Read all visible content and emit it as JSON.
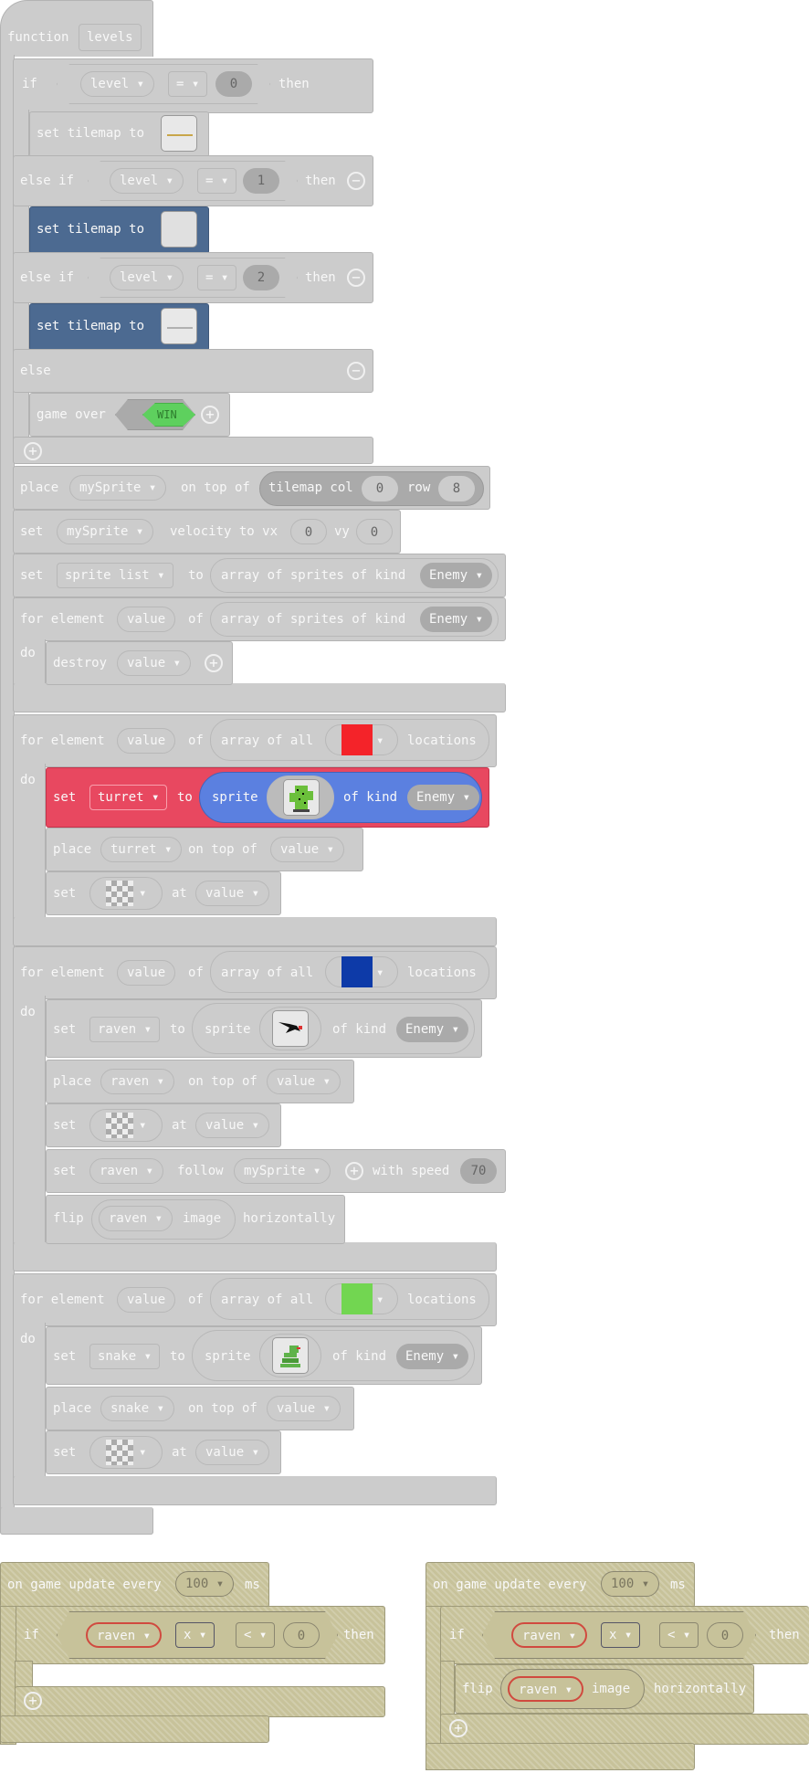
{
  "function_block": {
    "keyword": "function",
    "name": "levels"
  },
  "if_level0": {
    "if": "if",
    "var": "level",
    "op": "=",
    "value": "0",
    "then": "then"
  },
  "set_tilemap_1": {
    "label1": "set tilemap to"
  },
  "elseif_level1": {
    "elseif": "else if",
    "var": "level",
    "op": "=",
    "value": "1",
    "then": "then"
  },
  "set_tilemap_2": {
    "label1": "set tilemap to"
  },
  "elseif_level2": {
    "elseif": "else if",
    "var": "level",
    "op": "=",
    "value": "2",
    "then": "then"
  },
  "set_tilemap_3": {
    "label1": "set tilemap to"
  },
  "else_block": {
    "else": "else"
  },
  "game_over": {
    "label": "game over",
    "result": "WIN"
  },
  "place_mysprite": {
    "place": "place",
    "sprite": "mySprite",
    "on_top_of": "on top of",
    "tilemap_col": "tilemap col",
    "col": "0",
    "row_label": "row",
    "row": "8"
  },
  "set_velocity": {
    "set": "set",
    "sprite": "mySprite",
    "velocity": "velocity to vx",
    "vx": "0",
    "vy_label": "vy",
    "vy": "0"
  },
  "set_sprite_list": {
    "set": "set",
    "var": "sprite list",
    "to": "to",
    "array": "array of sprites of kind",
    "kind": "Enemy"
  },
  "for_destroy": {
    "for_element": "for element",
    "var": "value",
    "of": "of",
    "array": "array of sprites of kind",
    "kind": "Enemy",
    "do": "do",
    "destroy": "destroy",
    "destroy_var": "value"
  },
  "for_red": {
    "for_element": "for element",
    "var": "value",
    "of": "of",
    "array": "array of all",
    "locations": "locations",
    "do": "do",
    "color": "#f42329",
    "set": "set",
    "set_var": "turret",
    "to": "to",
    "sprite": "sprite",
    "of_kind": "of kind",
    "kind": "Enemy",
    "place": "place",
    "place_var": "turret",
    "on_top_of": "on top of",
    "target": "value",
    "set2": "set",
    "at": "at",
    "at_var": "value"
  },
  "for_blue": {
    "for_element": "for element",
    "var": "value",
    "of": "of",
    "array": "array of all",
    "locations": "locations",
    "do": "do",
    "color": "#0d3aa8",
    "set": "set",
    "set_var": "raven",
    "to": "to",
    "sprite": "sprite",
    "of_kind": "of kind",
    "kind": "Enemy",
    "place": "place",
    "place_var": "raven",
    "on_top_of": "on top of",
    "target": "value",
    "set2": "set",
    "at": "at",
    "at_var": "value",
    "follow_set": "set",
    "follow_var": "raven",
    "follow": "follow",
    "follow_target": "mySprite",
    "with_speed": "with speed",
    "speed": "70",
    "flip": "flip",
    "flip_var": "raven",
    "image": "image",
    "horizontally": "horizontally"
  },
  "for_green": {
    "for_element": "for element",
    "var": "value",
    "of": "of",
    "array": "array of all",
    "locations": "locations",
    "do": "do",
    "color": "#72d651",
    "set": "set",
    "set_var": "snake",
    "to": "to",
    "sprite": "sprite",
    "of_kind": "of kind",
    "kind": "Enemy",
    "place": "place",
    "place_var": "snake",
    "on_top_of": "on top of",
    "target": "value",
    "set2": "set",
    "at": "at",
    "at_var": "value"
  },
  "update_left": {
    "on": "on game update every",
    "ms_value": "100",
    "ms": "ms",
    "if": "if",
    "var": "raven",
    "prop": "x",
    "op": "<",
    "value": "0",
    "then": "then"
  },
  "update_right": {
    "on": "on game update every",
    "ms_value": "100",
    "ms": "ms",
    "if": "if",
    "var": "raven",
    "prop": "x",
    "op": "<",
    "value": "0",
    "then": "then",
    "flip": "flip",
    "flip_var": "raven",
    "image": "image",
    "horizontally": "horizontally"
  }
}
